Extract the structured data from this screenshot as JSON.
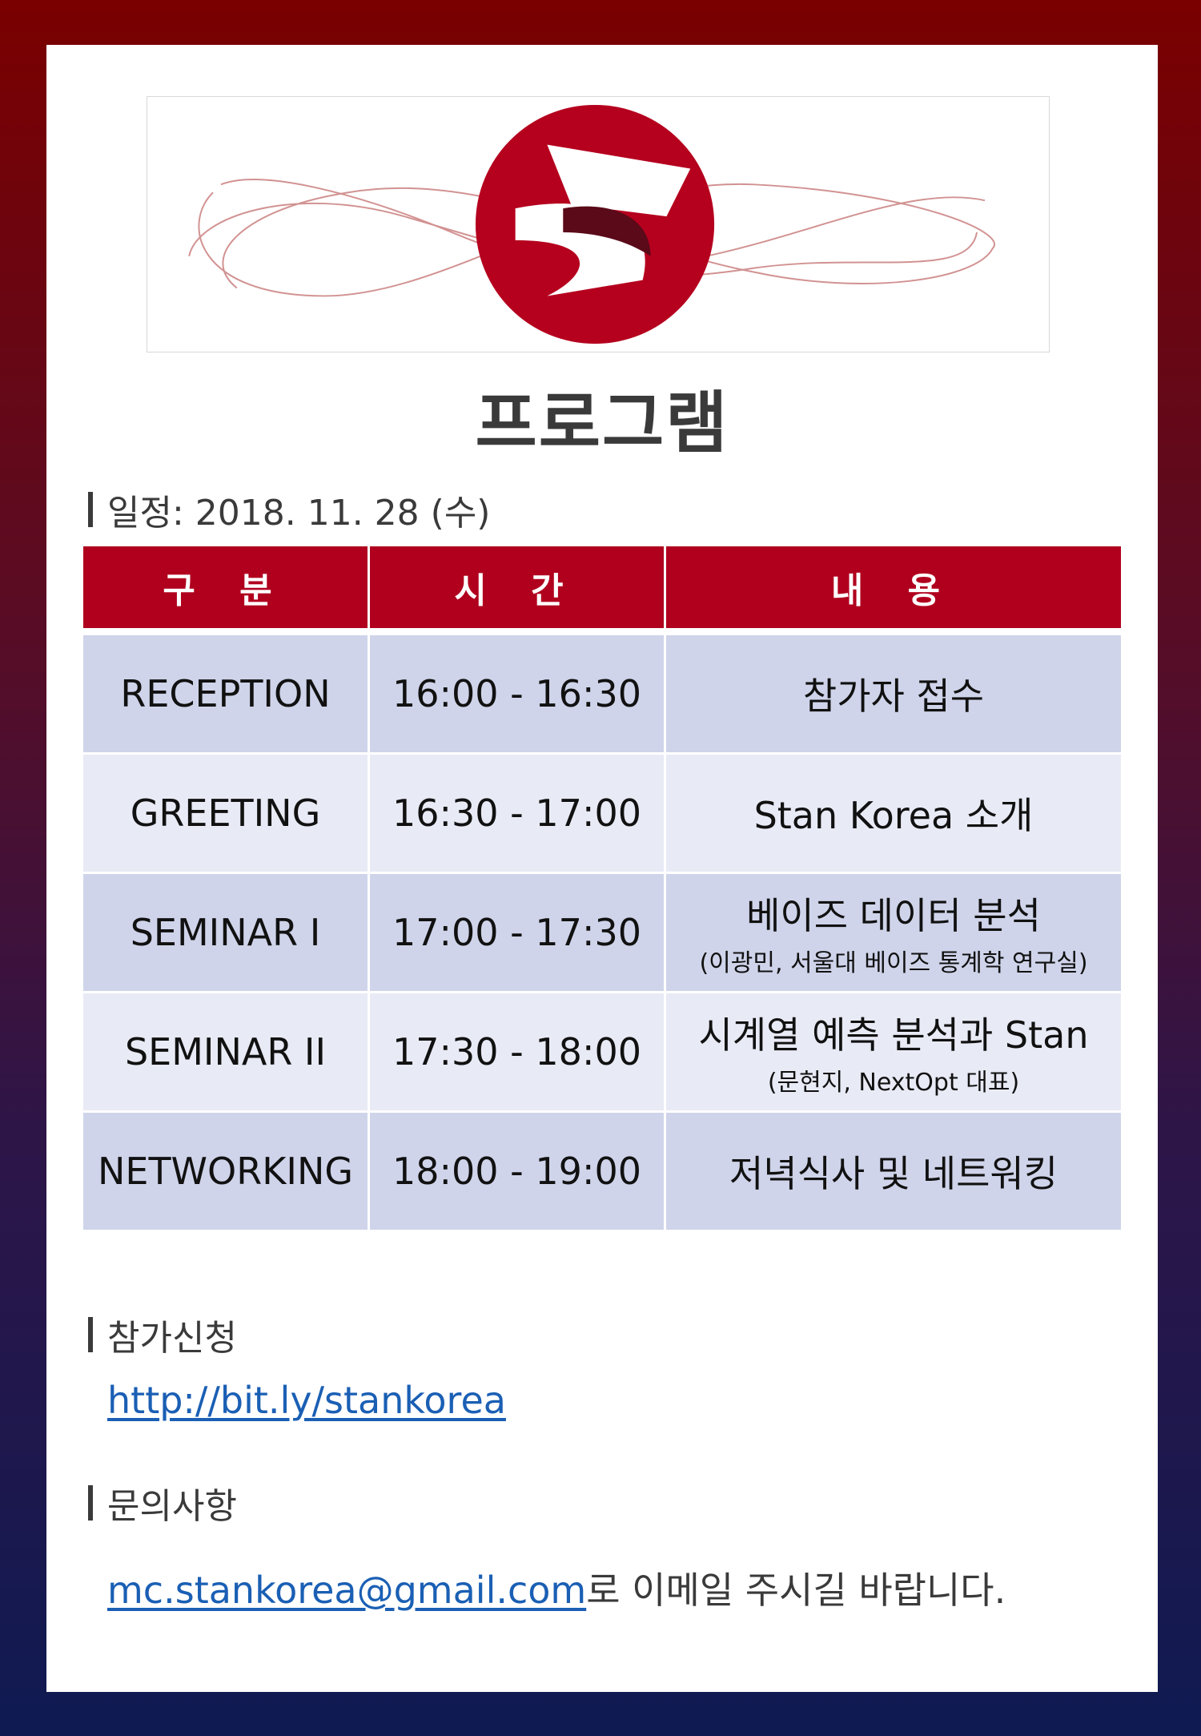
{
  "title": "프로그램",
  "schedule": {
    "label": "일정: 2018. 11. 28 (수)"
  },
  "table": {
    "headers": [
      "구 분",
      "시 간",
      "내 용"
    ],
    "rows": [
      {
        "category": "RECEPTION",
        "time": "16:00 - 16:30",
        "content": "참가자 접수",
        "note": ""
      },
      {
        "category": "GREETING",
        "time": "16:30 - 17:00",
        "content": "Stan Korea 소개",
        "note": ""
      },
      {
        "category": "SEMINAR I",
        "time": "17:00 - 17:30",
        "content": "베이즈 데이터 분석",
        "note": "(이광민, 서울대 베이즈 통계학 연구실)"
      },
      {
        "category": "SEMINAR II",
        "time": "17:30 - 18:00",
        "content": "시계열 예측 분석과 Stan",
        "note": "(문현지, NextOpt 대표)"
      },
      {
        "category": "NETWORKING",
        "time": "18:00 - 19:00",
        "content": "저녁식사 및 네트워킹",
        "note": ""
      }
    ]
  },
  "registration": {
    "label": "참가신청",
    "link": "http://bit.ly/stankorea"
  },
  "inquiry": {
    "label": "문의사항",
    "email": "mc.stankorea@gmail.com",
    "suffix": "로 이메일 주시길 바랍니다."
  },
  "colors": {
    "brand_red": "#b0001e",
    "row_dark": "#cfd4ea",
    "row_light": "#e8eaf5",
    "link": "#1a5fb4"
  }
}
